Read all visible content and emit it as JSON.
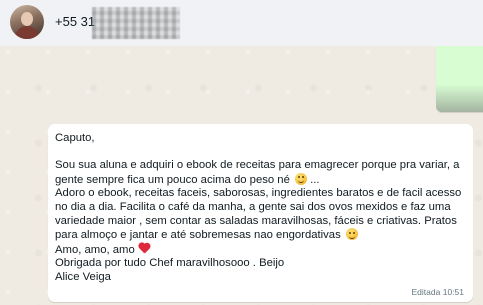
{
  "header": {
    "contact_phone_prefix": "+55 31"
  },
  "message": {
    "lines": [
      "Caputo,",
      "",
      "Sou sua aluna e adquiri o ebook de receitas para emagrecer porque pra variar, a",
      "gente sempre fica um pouco acima do peso né",
      "Adoro o ebook, receitas faceis, saborosas, ingredientes baratos e de facil acesso",
      "no dia a dia. Facilita o café da manha, a gente sai dos ovos mexidos e faz uma",
      "variedade maior , sem contar as saladas maravilhosas, fáceis e criativas. Pratos",
      "para almoço e jantar e até sobremesas nao engordativas",
      "Amo, amo, amo",
      "Obrigada por tudo Chef maravilhosooo . Beijo",
      "Alice Veiga"
    ],
    "ellipsis": " ...",
    "emojis": [
      "winking-face",
      "smiling-face",
      "red-heart"
    ],
    "status": "Editada",
    "time": "10:51"
  }
}
